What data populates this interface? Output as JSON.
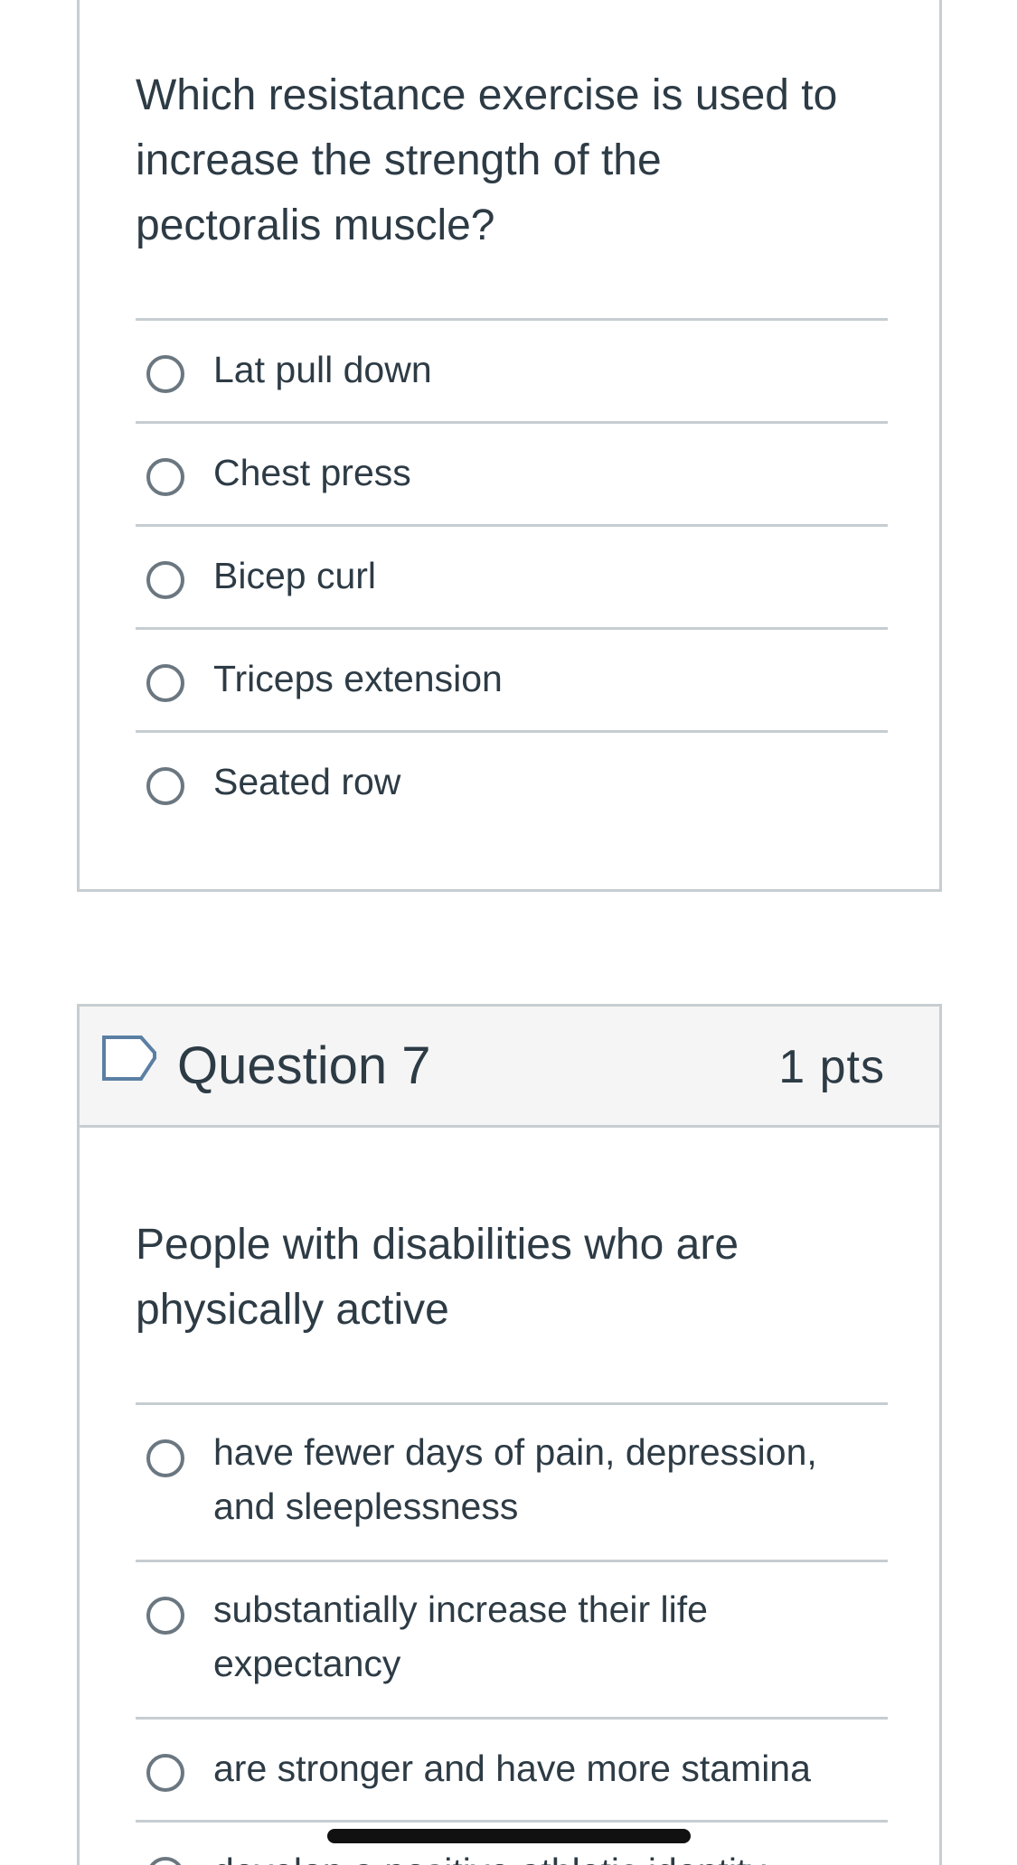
{
  "question6": {
    "text": "Which resistance exercise is used to increase the strength of the pectoralis muscle?",
    "answers": [
      {
        "label": "Lat pull down"
      },
      {
        "label": "Chest press"
      },
      {
        "label": "Bicep curl"
      },
      {
        "label": "Triceps extension"
      },
      {
        "label": "Seated row"
      }
    ]
  },
  "question7": {
    "title": "Question 7",
    "points": "1 pts",
    "text": "People with disabilities who are physically active",
    "flag_icon": "bookmark-flag-icon",
    "answers": [
      {
        "label": "have fewer days of pain, depression, and sleeplessness"
      },
      {
        "label": "substantially increase their life expectancy"
      },
      {
        "label": "are stronger and have more stamina"
      },
      {
        "label": "develop a positive athletic identity"
      }
    ]
  },
  "colors": {
    "text": "#2d3b45",
    "border": "#c7cdd1",
    "header_bg": "#f5f5f5",
    "radio_border": "#6b7780",
    "flag": "#5b7fa3"
  }
}
